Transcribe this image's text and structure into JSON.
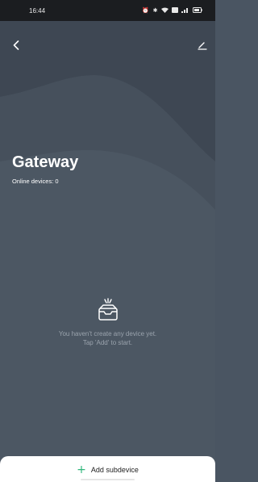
{
  "status_bar": {
    "time": "16:44",
    "icons": [
      "alarm-icon",
      "bluetooth-icon",
      "wifi-icon",
      "sim-icon",
      "signal-icon",
      "battery-icon"
    ]
  },
  "header": {
    "back_icon": "chevron-left-icon",
    "edit_icon": "pencil-icon"
  },
  "gateway": {
    "title": "Gateway",
    "online_devices": "Online devices: 0"
  },
  "empty_state": {
    "icon": "empty-tray-icon",
    "line1": "You haven't create any device yet.",
    "line2": "Tap 'Add' to start."
  },
  "bottom": {
    "add_label": "Add subdevice",
    "add_icon": "plus-icon",
    "accent_color": "#2fb67a"
  },
  "colors": {
    "background": "#4d5864",
    "status_bar": "#1b1d20"
  }
}
